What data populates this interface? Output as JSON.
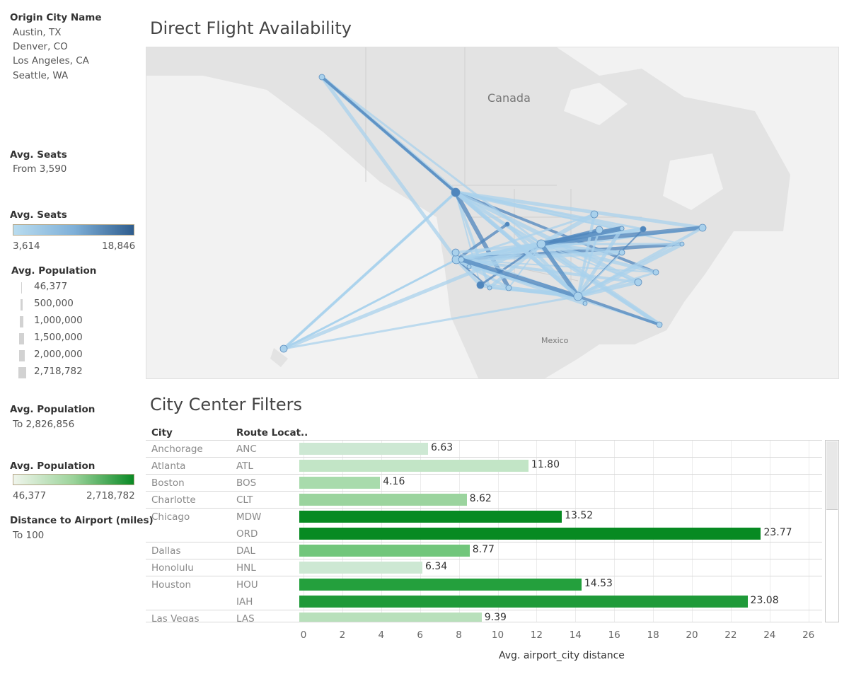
{
  "sidebar": {
    "origin_title": "Origin City Name",
    "origin_items": [
      "Austin, TX",
      "Denver, CO",
      "Los Angeles, CA",
      "Seattle, WA"
    ],
    "seats_filter_title": "Avg. Seats",
    "seats_filter_value": "From 3,590",
    "seats_legend_title": "Avg. Seats",
    "seats_legend_min": "3,614",
    "seats_legend_max": "18,846",
    "pop_size_title": "Avg. Population",
    "pop_size_items": [
      "46,377",
      "500,000",
      "1,000,000",
      "1,500,000",
      "2,000,000",
      "2,718,782"
    ],
    "pop_filter_title": "Avg. Population",
    "pop_filter_value": "To 2,826,856",
    "pop_legend_title": "Avg. Population",
    "pop_legend_min": "46,377",
    "pop_legend_max": "2,718,782",
    "distance_title": "Distance to Airport (miles)",
    "distance_value": "To 100"
  },
  "map": {
    "title": "Direct Flight Availability",
    "label_canada": "Canada",
    "label_mexico": "Mexico",
    "land_color": "#e3e3e3",
    "water_color": "#f2f2f2",
    "route_light": "#a9d1ec",
    "route_dark": "#4f86bd"
  },
  "table": {
    "title": "City Center Filters",
    "col_city": "City",
    "col_route": "Route Locat..",
    "axis_title": "Avg. airport_city distance",
    "ticks": [
      "0",
      "2",
      "4",
      "6",
      "8",
      "10",
      "12",
      "14",
      "16",
      "18",
      "20",
      "22",
      "24",
      "26"
    ],
    "rows": [
      {
        "city": "Anchorage",
        "code": "ANC",
        "value": 6.63,
        "label": "6.63",
        "color": "#cde8d3"
      },
      {
        "city": "Atlanta",
        "code": "ATL",
        "value": 11.8,
        "label": "11.80",
        "color": "#c2e5c6"
      },
      {
        "city": "Boston",
        "code": "BOS",
        "value": 4.16,
        "label": "4.16",
        "color": "#a8dbac"
      },
      {
        "city": "Charlotte",
        "code": "CLT",
        "value": 8.62,
        "label": "8.62",
        "color": "#9bd49e"
      },
      {
        "city": "Chicago",
        "code": "MDW",
        "value": 13.52,
        "label": "13.52",
        "color": "#078a22"
      },
      {
        "city": "",
        "code": "ORD",
        "value": 23.77,
        "label": "23.77",
        "color": "#078a22"
      },
      {
        "city": "Dallas",
        "code": "DAL",
        "value": 8.77,
        "label": "8.77",
        "color": "#71c67b"
      },
      {
        "city": "Honolulu",
        "code": "HNL",
        "value": 6.34,
        "label": "6.34",
        "color": "#cde8d3"
      },
      {
        "city": "Houston",
        "code": "HOU",
        "value": 14.53,
        "label": "14.53",
        "color": "#24a03d"
      },
      {
        "city": "",
        "code": "IAH",
        "value": 23.08,
        "label": "23.08",
        "color": "#1f9a39"
      },
      {
        "city": "Las Vegas",
        "code": "LAS",
        "value": 9.39,
        "label": "9.39",
        "color": "#b8e0bb"
      }
    ]
  },
  "chart_data": {
    "type": "bar",
    "orientation": "horizontal",
    "title": "City Center Filters",
    "xlabel": "Avg. airport_city distance",
    "xlim": [
      0,
      26
    ],
    "categories": [
      "Anchorage ANC",
      "Atlanta ATL",
      "Boston BOS",
      "Charlotte CLT",
      "Chicago MDW",
      "Chicago ORD",
      "Dallas DAL",
      "Honolulu HNL",
      "Houston HOU",
      "Houston IAH",
      "Las Vegas LAS"
    ],
    "values": [
      6.63,
      11.8,
      4.16,
      8.62,
      13.52,
      23.77,
      8.77,
      6.34,
      14.53,
      23.08,
      9.39
    ],
    "grid": "vertical"
  }
}
